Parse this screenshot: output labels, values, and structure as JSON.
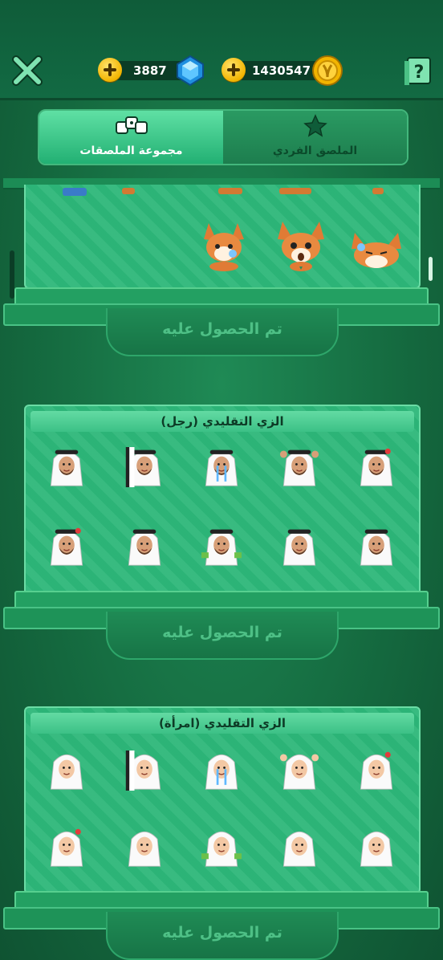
{
  "header": {
    "gems": {
      "value": "3887"
    },
    "coins": {
      "value": "1430547"
    }
  },
  "tabs": [
    {
      "label": "مجموعة الملصقات",
      "icon": "sticker-group-icon",
      "active": true
    },
    {
      "label": "الملصق الفردي",
      "icon": "star-icon",
      "active": false
    }
  ],
  "packs": [
    {
      "title": "",
      "status": "تم الحصول عليه",
      "stickers": [
        "fox-embarrassed",
        "fox-shocked",
        "fox-crying"
      ]
    },
    {
      "title": "الزي التقليدي (رجل)",
      "status": "تم الحصول عليه",
      "stickers": [
        "man-humming",
        "man-peeking",
        "man-crying",
        "man-cheering",
        "man-angry-talking",
        "man-furious",
        "man-smiling",
        "man-money",
        "man-shrugging",
        "man-winking"
      ]
    },
    {
      "title": "الزي التقليدي (امرأة)",
      "status": "تم الحصول عليه",
      "stickers": [
        "woman-humming",
        "woman-peeking",
        "woman-crying",
        "woman-cheering",
        "woman-sulking",
        "woman-angry",
        "woman-pleading",
        "woman-money",
        "woman-shrugging",
        "woman-winking"
      ]
    }
  ],
  "colors": {
    "bg": "#156b40",
    "panel": "#2db779",
    "accent": "#5fe0a4",
    "coin": "#f2b400",
    "gem": "#2ea7ff"
  }
}
